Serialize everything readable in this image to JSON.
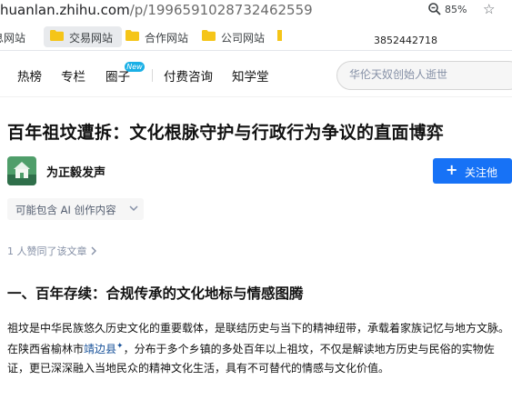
{
  "browser": {
    "url_host": "huanlan.zhihu.com",
    "url_path": "/p/1996591028732462559",
    "zoom": "85%"
  },
  "bookmarks": {
    "items": [
      {
        "label": "息网站"
      },
      {
        "label": "交易网站"
      },
      {
        "label": "合作网站"
      },
      {
        "label": "公司网站"
      }
    ],
    "phone_text": "3852442718"
  },
  "nav": {
    "items": [
      "热榜",
      "专栏",
      "圈子",
      "付费咨询",
      "知学堂"
    ],
    "new_badge": "New",
    "search_placeholder": "华伦天奴创始人逝世"
  },
  "article": {
    "title": "百年祖坟遭拆：文化根脉守护与行政行为争议的直面博弈",
    "author": "为正毅发声",
    "follow_label": "关注他",
    "ai_tag": "可能包含 AI 创作内容",
    "likes": "1 人赞同了该文章",
    "section_heading": "一、百年存续：合规传承的文化地标与情感图腾",
    "paragraph": {
      "before_link": "祖坟是中华民族悠久历史文化的重要载体，是联结历史与当下的精神纽带，承载着家族记忆与地方文脉。在陕西省榆林市",
      "link": "靖边县",
      "after_link": "，分布于多个乡镇的多处百年以上祖坟，不仅是解读地方历史与民俗的实物佐证，更已深深融入当地民众的精神文化生活，具有不可替代的情感与文化价值。"
    }
  },
  "colors": {
    "accent": "#1772f6",
    "folder": "#f5c518",
    "new_badge": "#1ab0e6",
    "link": "#175199"
  },
  "icons": [
    "magnifier-zoom-icon",
    "star-icon",
    "folder-icon",
    "plus-icon",
    "chevron-down-icon",
    "chevron-right-icon",
    "avatar-icon"
  ]
}
